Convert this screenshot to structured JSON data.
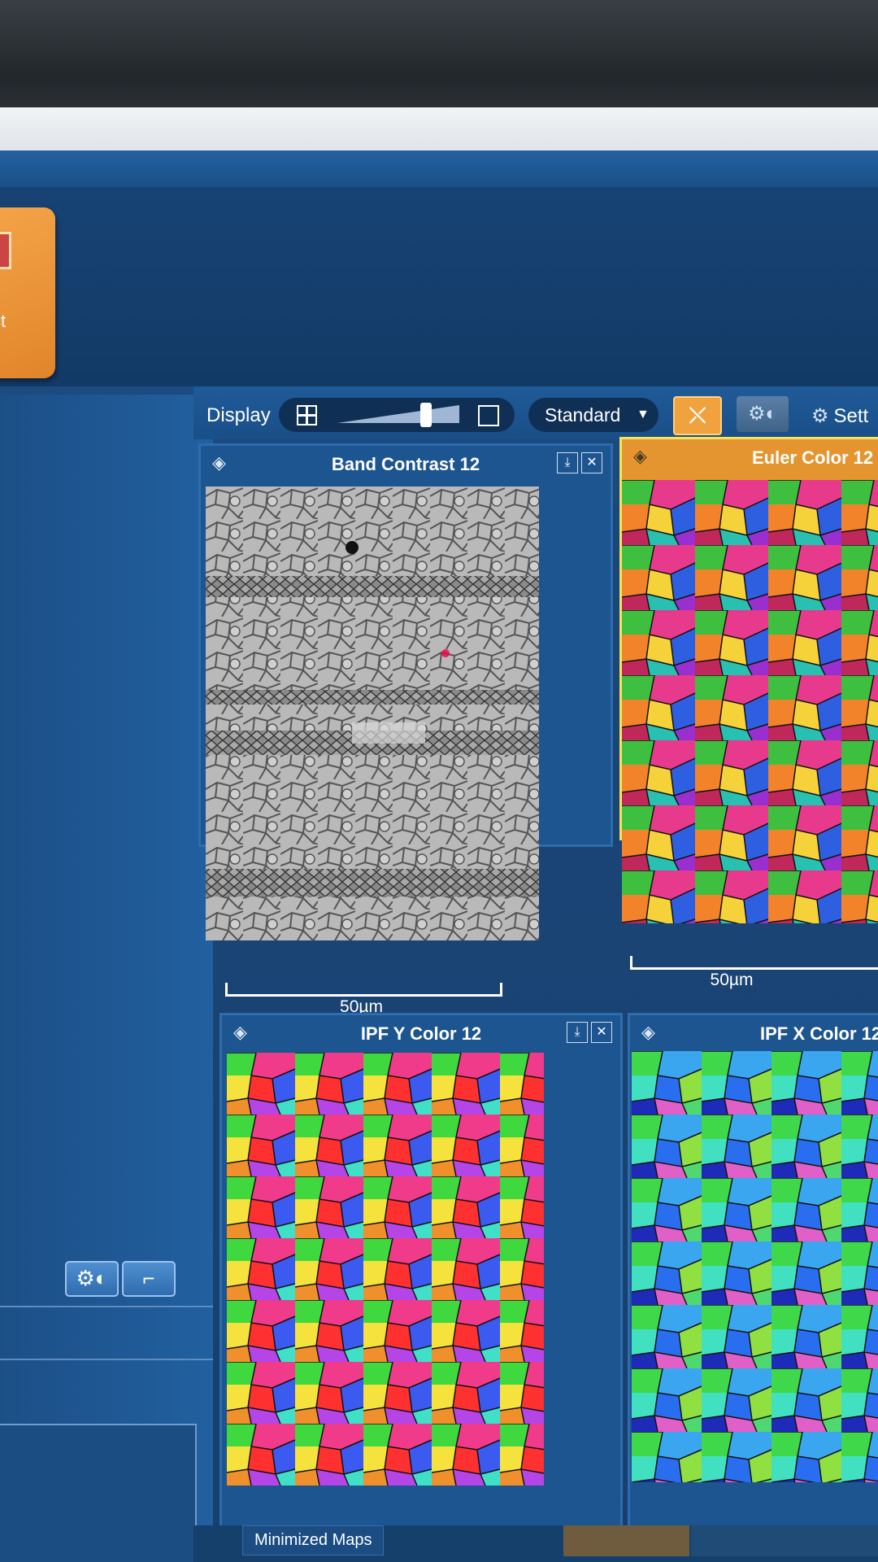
{
  "ribbon": {
    "action_label": "ct"
  },
  "toolbar": {
    "display_label": "Display",
    "layout_mode": "Standard",
    "settings_label": "Sett",
    "link_glyph": "⤬",
    "brightness_glyph": "⚙◐"
  },
  "left_panel": {
    "settings_glyph": "⚙◐",
    "curve_glyph": "⌐"
  },
  "panels": [
    {
      "title": "Band Contrast 12",
      "scale_label": "50µm",
      "selected": false
    },
    {
      "title": "Euler Color 12",
      "scale_label": "50µm",
      "selected": true
    },
    {
      "title": "IPF Y Color 12",
      "scale_label": "",
      "selected": false
    },
    {
      "title": "IPF X Color 12",
      "scale_label": "",
      "selected": false
    }
  ],
  "bottom": {
    "minimized_maps_label": "Minimized Maps"
  },
  "colors": {
    "app_bg": "#1a4678",
    "accent_orange": "#f0a23e",
    "selected_border": "#f6e35a"
  }
}
